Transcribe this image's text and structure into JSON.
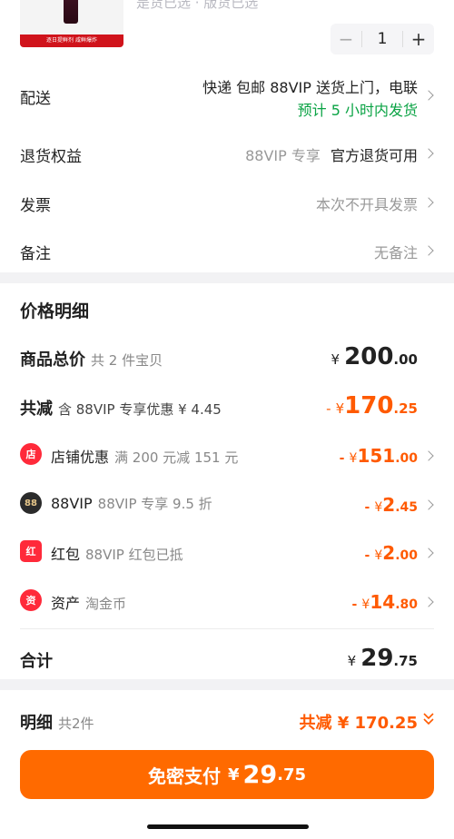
{
  "product": {
    "band_text": "逐日提鲜剂 咸鲜爆炸",
    "variant_text": "是货已选 · 版货已选",
    "quantity": "1",
    "minus": "−",
    "plus": "+"
  },
  "delivery": {
    "label": "配送",
    "value_line1": "快递 包邮 88VIP 送货上门，电联",
    "value_line2": "预计 5 小时内发货"
  },
  "returns": {
    "label": "退货权益",
    "tag": "88VIP 专享",
    "value": "官方退货可用"
  },
  "invoice": {
    "label": "发票",
    "value": "本次不开具发票"
  },
  "note": {
    "label": "备注",
    "value": "无备注"
  },
  "price": {
    "title": "价格明细",
    "total": {
      "label": "商品总价",
      "sub": "共 2 件宝贝",
      "yen": "¥",
      "int": "200",
      "dec": ".00"
    },
    "reduce": {
      "label": "共减",
      "sub": "含 88VIP 专享优惠 ¥ 4.45",
      "minus": "-",
      "yen": "¥",
      "int": "170",
      "dec": ".25"
    },
    "discounts": [
      {
        "icon": "店",
        "name": "店铺优惠",
        "desc": "满 200 元减 151 元",
        "minus": "-",
        "yen": "¥",
        "int": "151",
        "dec": ".00"
      },
      {
        "icon": "88",
        "name": "88VIP",
        "desc": "88VIP 专享 9.5 折",
        "minus": "-",
        "yen": "¥",
        "int": "2",
        "dec": ".45"
      },
      {
        "icon": "红",
        "name": "红包",
        "desc": "88VIP 红包已抵",
        "minus": "-",
        "yen": "¥",
        "int": "2",
        "dec": ".00"
      },
      {
        "icon": "资",
        "name": "资产",
        "desc": "淘金币",
        "minus": "-",
        "yen": "¥",
        "int": "14",
        "dec": ".80"
      }
    ],
    "sum": {
      "label": "合计",
      "yen": "¥",
      "int": "29",
      "dec": ".75"
    }
  },
  "detail": {
    "label": "明细",
    "sub": "共2件",
    "summary": "共减 ¥ 170.25"
  },
  "pay": {
    "text": "免密支付",
    "yen": "¥",
    "int": "29",
    "dec": ".75"
  },
  "colors": {
    "accent": "#ff6a00",
    "discount": "#ff5a00",
    "green": "#0aa344"
  }
}
